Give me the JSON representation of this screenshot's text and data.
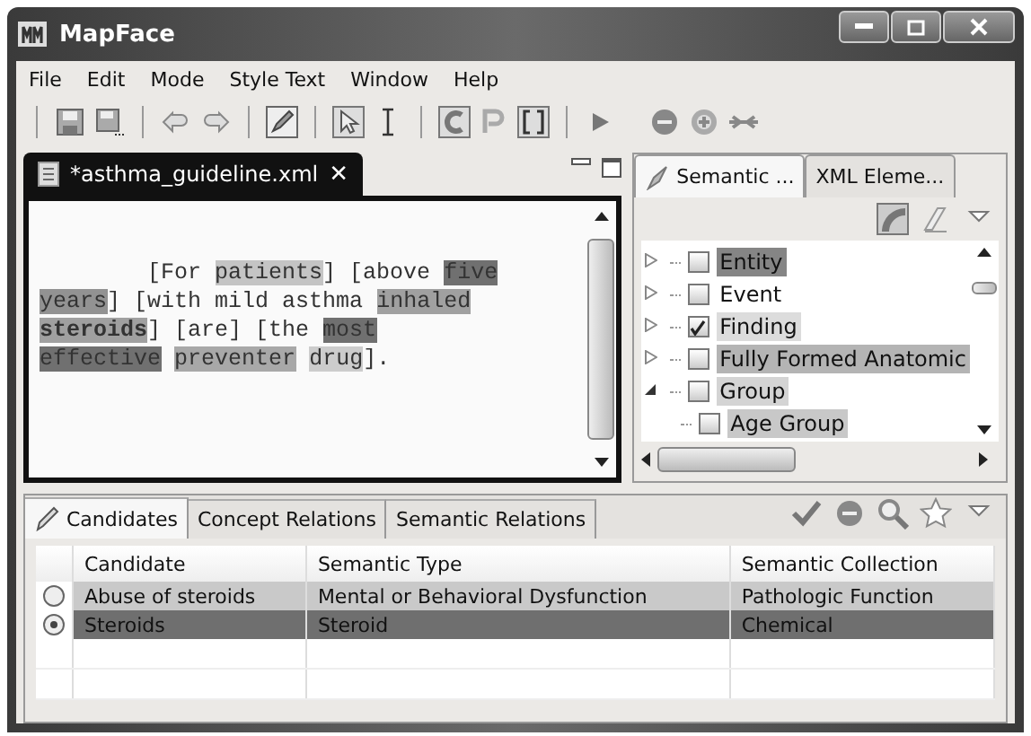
{
  "window": {
    "title": "MapFace"
  },
  "menu": [
    "File",
    "Edit",
    "Mode",
    "Style Text",
    "Window",
    "Help"
  ],
  "editor": {
    "tab": {
      "label": "*asthma_guideline.xml",
      "close": "✕"
    },
    "lines": [
      [
        {
          "text": "        [For "
        },
        {
          "text": "patients",
          "color": "#c4c4c4"
        },
        {
          "text": "] [above "
        },
        {
          "text": "five",
          "color": "#707070"
        }
      ],
      [
        {
          "text": "years",
          "color": "#929292"
        },
        {
          "text": "] [with mild asthma "
        },
        {
          "text": "inhaled",
          "color": "#a0a0a0"
        }
      ],
      [
        {
          "text": "steroids",
          "color": "#a0a0a0",
          "bold": true
        },
        {
          "text": "] [are] [the "
        },
        {
          "text": "most",
          "color": "#707070"
        }
      ],
      [
        {
          "text": "effective ",
          "color": "#707070"
        },
        {
          "text": "preventer ",
          "color": "#a8a8a8"
        },
        {
          "text": "drug",
          "color": "#cccccc"
        },
        {
          "text": "]."
        }
      ]
    ]
  },
  "side_panel": {
    "tabs": [
      {
        "label": "Semantic ...",
        "selected": true
      },
      {
        "label": "XML Eleme...",
        "selected": false
      }
    ],
    "tree": [
      {
        "label": "Entity",
        "checked": false,
        "expanded": false,
        "color": "#858585"
      },
      {
        "label": "Event",
        "checked": false,
        "expanded": false
      },
      {
        "label": "Finding",
        "checked": true,
        "expanded": false,
        "color": "#dcdcdc"
      },
      {
        "label": "Fully Formed Anatomic",
        "checked": false,
        "expanded": false,
        "color": "#b4b4b4"
      },
      {
        "label": "Group",
        "checked": false,
        "expanded": true,
        "color": "#d4d4d4",
        "children": [
          {
            "label": "Age Group",
            "checked": false,
            "color": "#c8c8c8"
          }
        ]
      }
    ]
  },
  "bottom_panel": {
    "tabs": [
      {
        "label": "Candidates",
        "selected": true
      },
      {
        "label": "Concept Relations",
        "selected": false
      },
      {
        "label": "Semantic Relations",
        "selected": false
      }
    ],
    "table": {
      "columns": [
        "Candidate",
        "Semantic Type",
        "Semantic Collection"
      ],
      "rows": [
        {
          "selected": false,
          "cells": [
            "Abuse of steroids",
            "Mental or Behavioral Dysfunction",
            "Pathologic Function"
          ]
        },
        {
          "selected": true,
          "cells": [
            "Steroids",
            "Steroid",
            "Chemical"
          ]
        }
      ]
    }
  }
}
